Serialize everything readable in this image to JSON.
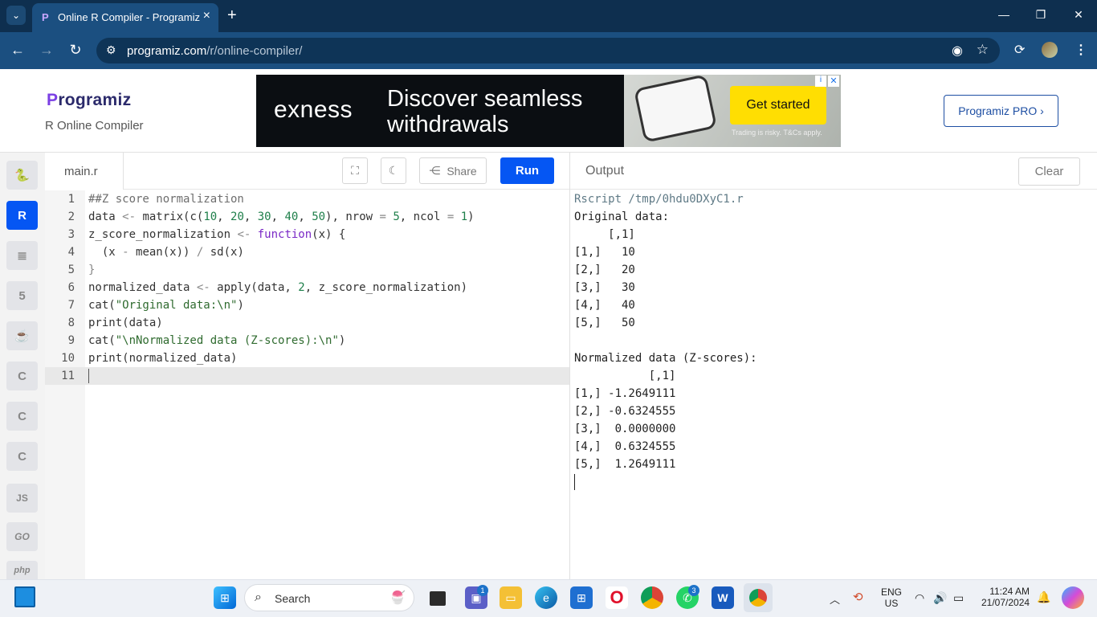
{
  "browser": {
    "tab_title": "Online R Compiler - Programiz",
    "url_host": "programiz.com",
    "url_path": "/r/online-compiler/"
  },
  "site": {
    "logo_p": "P",
    "logo_rest": "rogramiz",
    "subtitle": "R Online Compiler",
    "pro_button": "Programiz PRO ›"
  },
  "ad": {
    "brand": "exness",
    "headline_1": "Discover seamless",
    "headline_2": "withdrawals",
    "cta": "Get started",
    "fine_print": "Trading is risky. T&Cs apply."
  },
  "sidebar": {
    "items": [
      "python-icon",
      "r-icon",
      "sql-icon",
      "html5-icon",
      "java-icon",
      "c-icon",
      "cpp-icon",
      "csharp-icon",
      "js-icon",
      "go-icon",
      "php-icon"
    ],
    "labels": {
      "js": "JS",
      "go": "GO",
      "php": "php"
    }
  },
  "editor": {
    "file_tab": "main.r",
    "share_label": "Share",
    "run_label": "Run",
    "line_numbers": [
      "1",
      "2",
      "3",
      "4",
      "5",
      "6",
      "7",
      "8",
      "9",
      "10",
      "11"
    ]
  },
  "output": {
    "header": "Output",
    "clear_label": "Clear",
    "lines": [
      "Rscript /tmp/0hdu0DXyC1.r",
      "Original data:",
      "     [,1]",
      "[1,]   10",
      "[2,]   20",
      "[3,]   30",
      "[4,]   40",
      "[5,]   50",
      "",
      "Normalized data (Z-scores):",
      "           [,1]",
      "[1,] -1.2649111",
      "[2,] -0.6324555",
      "[3,]  0.0000000",
      "[4,]  0.6324555",
      "[5,]  1.2649111"
    ]
  },
  "taskbar": {
    "search_label": "Search",
    "chat_badge": "1",
    "whatsapp_badge": "3",
    "lang_1": "ENG",
    "lang_2": "US",
    "time": "11:24 AM",
    "date": "21/07/2024"
  }
}
